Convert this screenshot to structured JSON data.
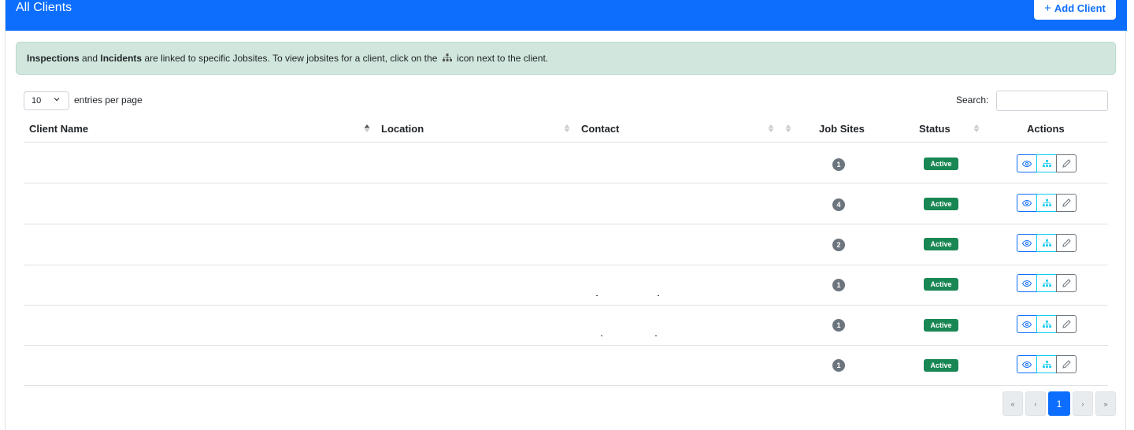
{
  "header": {
    "title": "All Clients",
    "add_button_label": "Add Client",
    "add_button_plus": "+"
  },
  "alert": {
    "bold1": "Inspections",
    "text1": " and ",
    "bold2": "Incidents",
    "text2": " are linked to specific Jobsites. To view jobsites for a client, click on the",
    "text3": "icon next to the client."
  },
  "length": {
    "value": "10",
    "label": "entries per page"
  },
  "search": {
    "label": "Search:",
    "value": "",
    "placeholder": ""
  },
  "columns": {
    "client_name": "Client Name",
    "location": "Location",
    "contact": "Contact",
    "job_sites": "Job Sites",
    "status": "Status",
    "actions": "Actions"
  },
  "rows": [
    {
      "job_sites": "1",
      "status": "Active"
    },
    {
      "job_sites": "4",
      "status": "Active"
    },
    {
      "job_sites": "2",
      "status": "Active"
    },
    {
      "job_sites": "1",
      "status": "Active"
    },
    {
      "job_sites": "1",
      "status": "Active"
    },
    {
      "job_sites": "1",
      "status": "Active"
    }
  ],
  "pagination": {
    "first": "«",
    "prev": "‹",
    "current": "1",
    "next": "›",
    "last": "»"
  },
  "colors": {
    "primary": "#0d6efd",
    "success": "#198754",
    "info": "#0dcaf0",
    "secondary": "#6c757d",
    "alert_bg": "#d1e7dd"
  },
  "icons": {
    "view": "eye-icon",
    "sites": "sitemap-icon",
    "edit": "pencil-icon"
  }
}
